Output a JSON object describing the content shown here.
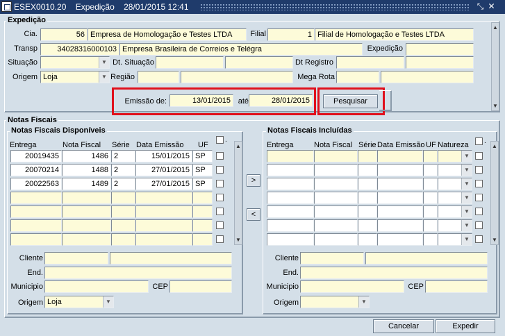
{
  "window": {
    "title": "ESEX0010.20    Expedição    28/01/2015 12:41"
  },
  "expedicao": {
    "section_title": "Expedição",
    "cia_label": "Cia.",
    "cia_code": "56",
    "cia_name": "Empresa de Homologação e Testes LTDA",
    "filial_label": "Filial",
    "filial_code": "1",
    "filial_name": "Filial de Homologação e Testes LTDA",
    "transp_label": "Transp",
    "transp_code": "34028316000103",
    "transp_name": "Empresa Brasileira de Correios e Telégra",
    "expedicao_label": "Expedição",
    "expedicao_value": "",
    "situacao_label": "Situação",
    "situacao_value": "",
    "dt_situacao_label": "Dt. Situação",
    "dt_registro_label": "Dt Registro",
    "origem_label": "Origem",
    "origem_value": "Loja",
    "regiao_label": "Região",
    "mega_rota_label": "Mega Rota",
    "emissao_label": "Emissão de:",
    "emissao_de": "13/01/2015",
    "ate_label": "até",
    "emissao_ate": "28/01/2015",
    "pesquisar_label": "Pesquisar"
  },
  "notas": {
    "section_title": "Notas Fiscais",
    "disponiveis": {
      "title": "Notas Fiscais Disponíveis",
      "columns": [
        "Entrega",
        "Nota Fiscal",
        "Série",
        "Data Emissão",
        "UF"
      ],
      "rows": [
        {
          "entrega": "20019435",
          "nota": "1486",
          "serie": "2",
          "data": "15/01/2015",
          "uf": "SP"
        },
        {
          "entrega": "20070214",
          "nota": "1488",
          "serie": "2",
          "data": "27/01/2015",
          "uf": "SP"
        },
        {
          "entrega": "20022563",
          "nota": "1489",
          "serie": "2",
          "data": "27/01/2015",
          "uf": "SP"
        },
        {
          "entrega": "",
          "nota": "",
          "serie": "",
          "data": "",
          "uf": ""
        },
        {
          "entrega": "",
          "nota": "",
          "serie": "",
          "data": "",
          "uf": ""
        },
        {
          "entrega": "",
          "nota": "",
          "serie": "",
          "data": "",
          "uf": ""
        },
        {
          "entrega": "",
          "nota": "",
          "serie": "",
          "data": "",
          "uf": ""
        }
      ],
      "cliente_label": "Cliente",
      "end_label": "End.",
      "municipio_label": "Municipio",
      "cep_label": "CEP",
      "origem_label": "Origem",
      "origem_value": "Loja"
    },
    "incluidas": {
      "title": "Notas Fiscais Incluídas",
      "columns": [
        "Entrega",
        "Nota Fiscal",
        "Série",
        "Data Emissão",
        "UF",
        "Natureza"
      ],
      "cliente_label": "Cliente",
      "end_label": "End.",
      "municipio_label": "Municipio",
      "cep_label": "CEP",
      "origem_label": "Origem",
      "origem_value": ""
    },
    "move_right": ">",
    "move_left": "<"
  },
  "footer": {
    "cancelar": "Cancelar",
    "expedir": "Expedir"
  }
}
